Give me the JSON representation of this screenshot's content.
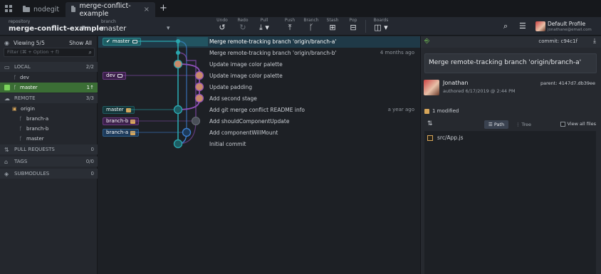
{
  "tabs": [
    {
      "label": "nodegit"
    },
    {
      "label": "merge-conflict-example"
    }
  ],
  "toolbar": {
    "repository_caption": "repository",
    "repository_name": "merge-conflict-example",
    "branch_caption": "branch",
    "branch_name": "master",
    "tools": [
      {
        "label": "Undo",
        "icon": "undo-icon"
      },
      {
        "label": "Redo",
        "icon": "redo-icon"
      },
      {
        "label": "Pull",
        "icon": "pull-icon"
      },
      {
        "label": "Push",
        "icon": "push-icon"
      },
      {
        "label": "Branch",
        "icon": "branch-icon"
      },
      {
        "label": "Stash",
        "icon": "stash-icon"
      },
      {
        "label": "Pop",
        "icon": "pop-icon"
      },
      {
        "label": "Boards",
        "icon": "boards-icon"
      }
    ],
    "profile_name": "Default Profile",
    "profile_email": "jonathane@email.com"
  },
  "left_panel": {
    "viewing": "Viewing 5/5",
    "show_all": "Show All",
    "filter_placeholder": "Filter (⌘ + Option + f)",
    "local": {
      "label": "LOCAL",
      "count": "2/2"
    },
    "local_branches": [
      {
        "name": "dev"
      },
      {
        "name": "master",
        "sync": "1↑"
      }
    ],
    "remote": {
      "label": "REMOTE",
      "count": "3/3"
    },
    "remote_name": "origin",
    "remote_branches": [
      "branch-a",
      "branch-b",
      "master"
    ],
    "pull_requests": {
      "label": "PULL REQUESTS",
      "count": "0"
    },
    "tags": {
      "label": "TAGS",
      "count": "0/0"
    },
    "submodules": {
      "label": "SUBMODULES",
      "count": "0"
    }
  },
  "graph": {
    "commits": [
      {
        "message": "Merge remote-tracking branch 'origin/branch-a'",
        "date": "",
        "ref": "master"
      },
      {
        "message": "Merge remote-tracking branch 'origin/branch-b'",
        "date": "4 months ago",
        "ref": ""
      },
      {
        "message": "Update image color palette",
        "date": "",
        "ref": ""
      },
      {
        "message": "Update image color palette",
        "date": "",
        "ref": "dev"
      },
      {
        "message": "Update padding",
        "date": "",
        "ref": ""
      },
      {
        "message": "Add second stage",
        "date": "",
        "ref": ""
      },
      {
        "message": "Add git merge conflict README info",
        "date": "a year ago",
        "ref": "master"
      },
      {
        "message": "Add shouldComponentUpdate",
        "date": "",
        "ref": "branch-b"
      },
      {
        "message": "Add componentWillMount",
        "date": "",
        "ref": "branch-a"
      },
      {
        "message": "Initial commit",
        "date": "",
        "ref": ""
      }
    ]
  },
  "right_panel": {
    "commit_label": "commit: c94c1f",
    "title": "Merge remote-tracking branch 'origin/branch-a'",
    "author": "Jonathan",
    "authored": "authored 6/17/2019 @ 2:44 PM",
    "parent": "parent: 4147d7.db39ee",
    "modified": "1 modified",
    "path_label": "Path",
    "tree_label": "Tree",
    "view_all": "View all files",
    "files": [
      "src/App.js"
    ]
  },
  "colors": {
    "accent_green": "#7bd35b",
    "lane_teal": "#2aa6ae",
    "lane_purple": "#8e4fb8",
    "lane_blue": "#3c7fd0",
    "selected_row": "#1f3947"
  }
}
